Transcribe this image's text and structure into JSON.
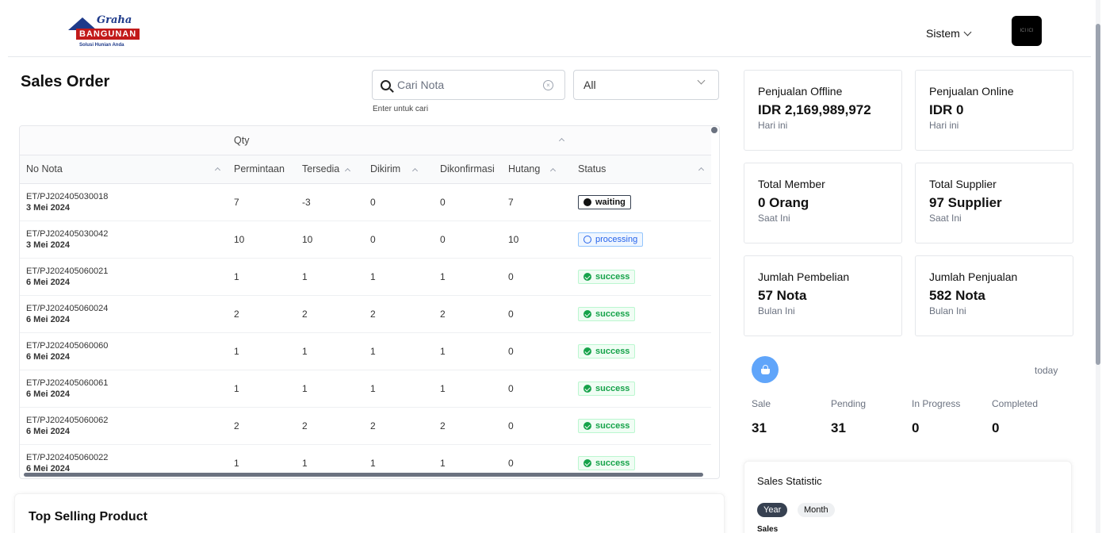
{
  "header": {
    "logo": {
      "script": "Graha",
      "brand": "BANGUNAN",
      "tagline": "Solusi Hunian Anda"
    },
    "menu_label": "Sistem",
    "avatar_text": "ICI ICI"
  },
  "sales_order": {
    "title": "Sales Order",
    "search": {
      "placeholder": "Cari Nota",
      "value": "",
      "hint": "Enter untuk cari"
    },
    "filter": {
      "selected": "All"
    },
    "table": {
      "group_header": "Qty",
      "columns": [
        "No Nota",
        "Permintaan",
        "Tersedia",
        "Dikirim",
        "Dikonfirmasi",
        "Hutang",
        "Status"
      ],
      "rows": [
        {
          "nota": "ET/PJ202405030018",
          "date": "3 Mei 2024",
          "permintaan": "7",
          "tersedia": "-3",
          "dikirim": "0",
          "dikonfirmasi": "0",
          "hutang": "7",
          "status": "waiting"
        },
        {
          "nota": "ET/PJ202405030042",
          "date": "3 Mei 2024",
          "permintaan": "10",
          "tersedia": "10",
          "dikirim": "0",
          "dikonfirmasi": "0",
          "hutang": "10",
          "status": "processing"
        },
        {
          "nota": "ET/PJ202405060021",
          "date": "6 Mei 2024",
          "permintaan": "1",
          "tersedia": "1",
          "dikirim": "1",
          "dikonfirmasi": "1",
          "hutang": "0",
          "status": "success"
        },
        {
          "nota": "ET/PJ202405060024",
          "date": "6 Mei 2024",
          "permintaan": "2",
          "tersedia": "2",
          "dikirim": "2",
          "dikonfirmasi": "2",
          "hutang": "0",
          "status": "success"
        },
        {
          "nota": "ET/PJ202405060060",
          "date": "6 Mei 2024",
          "permintaan": "1",
          "tersedia": "1",
          "dikirim": "1",
          "dikonfirmasi": "1",
          "hutang": "0",
          "status": "success"
        },
        {
          "nota": "ET/PJ202405060061",
          "date": "6 Mei 2024",
          "permintaan": "1",
          "tersedia": "1",
          "dikirim": "1",
          "dikonfirmasi": "1",
          "hutang": "0",
          "status": "success"
        },
        {
          "nota": "ET/PJ202405060062",
          "date": "6 Mei 2024",
          "permintaan": "2",
          "tersedia": "2",
          "dikirim": "2",
          "dikonfirmasi": "2",
          "hutang": "0",
          "status": "success"
        },
        {
          "nota": "ET/PJ202405060022",
          "date": "6 Mei 2024",
          "permintaan": "1",
          "tersedia": "1",
          "dikirim": "1",
          "dikonfirmasi": "1",
          "hutang": "0",
          "status": "success"
        }
      ]
    }
  },
  "top_selling": {
    "title": "Top Selling Product"
  },
  "cards": [
    {
      "label": "Penjualan Offline",
      "value": "IDR 2,169,989,972",
      "sub": "Hari ini"
    },
    {
      "label": "Penjualan Online",
      "value": "IDR 0",
      "sub": "Hari ini"
    },
    {
      "label": "Total Member",
      "value": "0 Orang",
      "sub": "Saat Ini"
    },
    {
      "label": "Total Supplier",
      "value": "97 Supplier",
      "sub": "Saat Ini"
    },
    {
      "label": "Jumlah Pembelian",
      "value": "57 Nota",
      "sub": "Bulan Ini"
    },
    {
      "label": "Jumlah Penjualan",
      "value": "582 Nota",
      "sub": "Bulan Ini"
    }
  ],
  "summary": {
    "period": "today",
    "stats": [
      {
        "label": "Sale",
        "value": "31"
      },
      {
        "label": "Pending",
        "value": "31"
      },
      {
        "label": "In Progress",
        "value": "0"
      },
      {
        "label": "Completed",
        "value": "0"
      }
    ]
  },
  "sales_statistic": {
    "title": "Sales Statistic",
    "tabs": [
      "Year",
      "Month"
    ],
    "active_tab": "Year",
    "series_label": "Sales"
  },
  "colors": {
    "waiting": "#111111",
    "processing": "#2563eb",
    "success": "#16a34a",
    "accent": "#60a5fa"
  }
}
